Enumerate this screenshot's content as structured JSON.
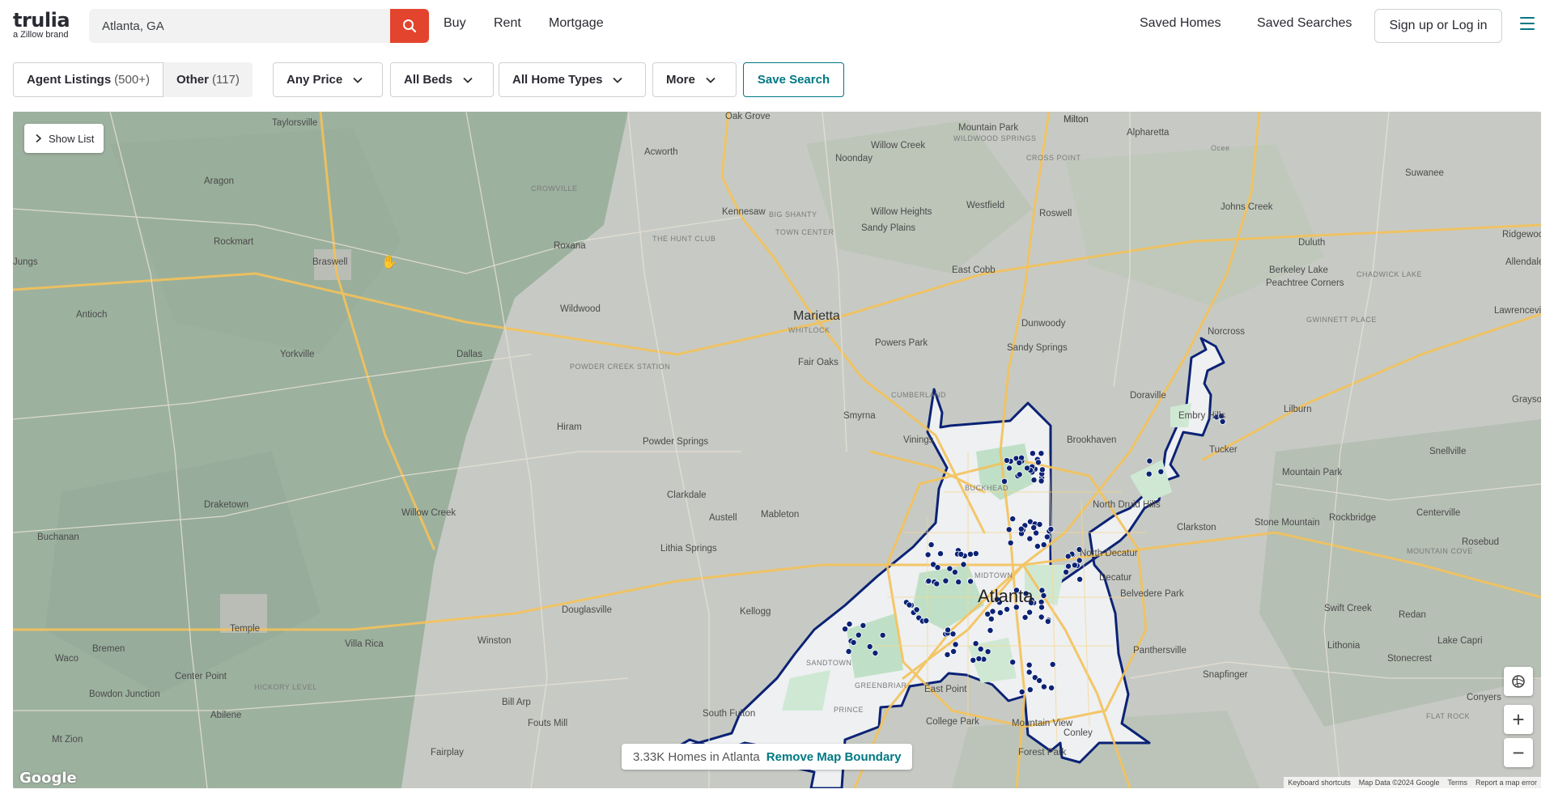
{
  "header": {
    "logo_word": "trulia",
    "logo_sub": "a Zillow brand",
    "search_value": "Atlanta, GA",
    "nav": [
      "Buy",
      "Rent",
      "Mortgage"
    ],
    "saved_homes": "Saved Homes",
    "saved_searches": "Saved Searches",
    "login": "Sign up or Log in"
  },
  "filters": {
    "agent_listings": "Agent Listings",
    "agent_count": "(500+)",
    "other": "Other",
    "other_count": "(117)",
    "price": "Any Price",
    "beds": "All Beds",
    "home_types": "All Home Types",
    "more": "More",
    "save_search": "Save Search"
  },
  "map": {
    "show_list": "Show List",
    "count_text": "3.33K Homes in Atlanta",
    "remove_boundary": "Remove Map Boundary",
    "zoom_in": "+",
    "zoom_out": "−",
    "google": "Google",
    "attribution": [
      "Keyboard shortcuts",
      "Map Data ©2024 Google",
      "Terms",
      "Report a map error"
    ],
    "places": [
      {
        "n": "Taylorsville"
      },
      {
        "n": "Oak Grove"
      },
      {
        "n": "Acworth"
      },
      {
        "n": "Mountain Park"
      },
      {
        "n": "Milton"
      },
      {
        "n": "Alpharetta"
      },
      {
        "n": "Willow Creek"
      },
      {
        "n": "Noonday"
      },
      {
        "n": "Aragon"
      },
      {
        "n": "CROWVILLE"
      },
      {
        "n": "Kennesaw"
      },
      {
        "n": "BIG SHANTY"
      },
      {
        "n": "Westfield"
      },
      {
        "n": "Roswell"
      },
      {
        "n": "Johns Creek"
      },
      {
        "n": "Suwanee"
      },
      {
        "n": "Rockmart"
      },
      {
        "n": "Roxana"
      },
      {
        "n": "THE HUNT CLUB"
      },
      {
        "n": "TOWN CENTER"
      },
      {
        "n": "Sandy Plains"
      },
      {
        "n": "Willow Heights"
      },
      {
        "n": "Duluth"
      },
      {
        "n": "Ridgewood"
      },
      {
        "n": "Braswell"
      },
      {
        "n": "East Cobb"
      },
      {
        "n": "Berkeley Lake"
      },
      {
        "n": "Allendale"
      },
      {
        "n": "Antioch"
      },
      {
        "n": "Wildwood"
      },
      {
        "n": "Marietta"
      },
      {
        "n": "WHITLOCK"
      },
      {
        "n": "Dunwoody"
      },
      {
        "n": "Peachtree Corners"
      },
      {
        "n": "CHADWICK LAKE"
      },
      {
        "n": "Lawrenceville"
      },
      {
        "n": "Dallas"
      },
      {
        "n": "POWDER CREEK STATION"
      },
      {
        "n": "Fair Oaks"
      },
      {
        "n": "Powers Park"
      },
      {
        "n": "Sandy Springs"
      },
      {
        "n": "Norcross"
      },
      {
        "n": "GWINNETT PLACE"
      },
      {
        "n": "Yorkville"
      },
      {
        "n": "CUMBERLAND"
      },
      {
        "n": "Doraville"
      },
      {
        "n": "Embry Hills"
      },
      {
        "n": "Lilburn"
      },
      {
        "n": "Grayson"
      },
      {
        "n": "Smyrna"
      },
      {
        "n": "Vinings"
      },
      {
        "n": "Brookhaven"
      },
      {
        "n": "Hiram"
      },
      {
        "n": "Powder Springs"
      },
      {
        "n": "Tucker"
      },
      {
        "n": "Mountain Park"
      },
      {
        "n": "Snellville"
      },
      {
        "n": "Draketown"
      },
      {
        "n": "Clarkdale"
      },
      {
        "n": "Mableton"
      },
      {
        "n": "Austell"
      },
      {
        "n": "BUCKHEAD"
      },
      {
        "n": "North Druid Hills"
      },
      {
        "n": "Clarkston"
      },
      {
        "n": "Stone Mountain"
      },
      {
        "n": "Rockbridge"
      },
      {
        "n": "Centerville"
      },
      {
        "n": "Buchanan"
      },
      {
        "n": "Willow Creek"
      },
      {
        "n": "Lithia Springs"
      },
      {
        "n": "North Decatur"
      },
      {
        "n": "MOUNTAIN COVE"
      },
      {
        "n": "Rosebud"
      },
      {
        "n": "Decatur"
      },
      {
        "n": "MIDTOWN"
      },
      {
        "n": "Atlanta"
      },
      {
        "n": "Belvedere Park"
      },
      {
        "n": "Swift Creek"
      },
      {
        "n": "Kellogg"
      },
      {
        "n": "Douglasville"
      },
      {
        "n": "Temple"
      },
      {
        "n": "Villa Rica"
      },
      {
        "n": "Winston"
      },
      {
        "n": "Redan"
      },
      {
        "n": "Bremen"
      },
      {
        "n": "Panthersville"
      },
      {
        "n": "Lithonia"
      },
      {
        "n": "Lake Capri"
      },
      {
        "n": "Waco"
      },
      {
        "n": "Stonecrest"
      },
      {
        "n": "Center Point"
      },
      {
        "n": "HICKORY LEVEL"
      },
      {
        "n": "SANDTOWN"
      },
      {
        "n": "Snapfinger"
      },
      {
        "n": "Bowdon Junction"
      },
      {
        "n": "GREENBRIAR"
      },
      {
        "n": "East Point"
      },
      {
        "n": "Conyers"
      },
      {
        "n": "Bill Arp"
      },
      {
        "n": "South Fulton"
      },
      {
        "n": "PRINCE"
      },
      {
        "n": "College Park"
      },
      {
        "n": "Abilene"
      },
      {
        "n": "Fouts Mill"
      },
      {
        "n": "Mountain View"
      },
      {
        "n": "FLAT ROCK"
      },
      {
        "n": "Mt Zion"
      },
      {
        "n": "Conley"
      },
      {
        "n": "Fairplay"
      },
      {
        "n": "Forest Park"
      },
      {
        "n": "Jungs"
      },
      {
        "n": "Milton"
      },
      {
        "n": "Ocee"
      },
      {
        "n": "CROSS POINT"
      },
      {
        "n": "WILDWOOD SPRINGS"
      }
    ]
  },
  "colors": {
    "brand_red": "#e3442e",
    "teal": "#007882",
    "boundary": "#0b2275",
    "pin": "#0b2275"
  }
}
